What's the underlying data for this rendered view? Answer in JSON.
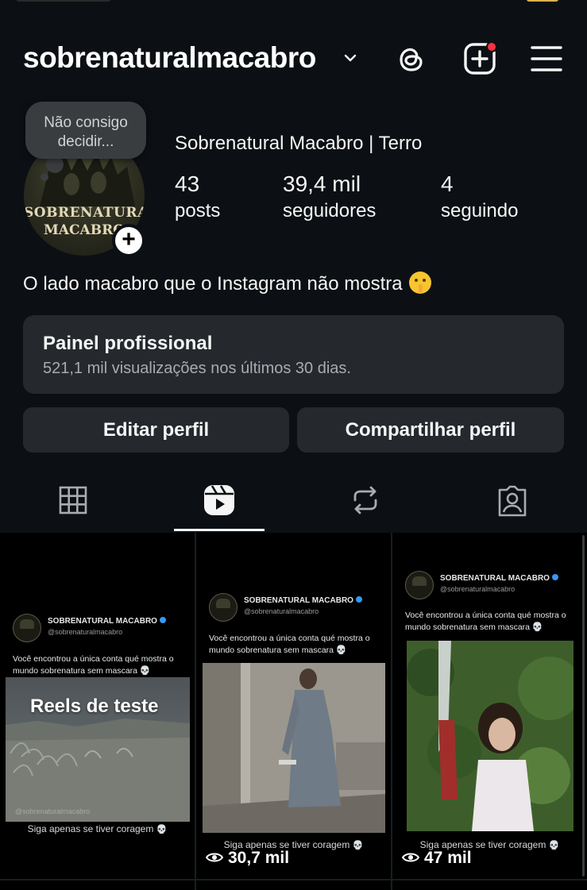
{
  "header": {
    "username": "sobrenaturalmacabro"
  },
  "profile": {
    "note": "Não consigo decidir...",
    "avatar_line1": "SOBRENATURAL",
    "avatar_line2": "MACABRO",
    "display_name": "Sobrenatural Macabro | Terro",
    "stats": [
      {
        "value": "43",
        "label": "posts"
      },
      {
        "value": "39,4 mil",
        "label": "seguidores"
      },
      {
        "value": "4",
        "label": "seguindo"
      }
    ],
    "bio": "O lado macabro que o Instagram não mostra"
  },
  "dashboard": {
    "title": "Painel profissional",
    "subtitle": "521,1 mil visualizações nos últimos 30 dias."
  },
  "buttons": {
    "edit": "Editar perfil",
    "share": "Compartilhar perfil"
  },
  "reels": [
    {
      "account_name": "SOBRENATURAL MACABRO",
      "handle": "@sobrenaturalmacabro",
      "caption": "Você encontrou a única conta qué mostra o mundo sobrenatura sem mascara",
      "footer": "Siga apenas se tiver coragem",
      "overlay_title": "Reels de teste",
      "watermark": "@sobrenaturalmacabro",
      "views": ""
    },
    {
      "account_name": "SOBRENATURAL MACABRO",
      "handle": "@sobrenaturalmacabro",
      "caption": "Você encontrou a única conta qué mostra o mundo sobrenatura sem mascara",
      "footer": "Siga apenas se tiver coragem",
      "views": "30,7 mil"
    },
    {
      "account_name": "SOBRENATURAL MACABRO",
      "handle": "@sobrenaturalmacabro",
      "caption": "Você encontrou a única conta qué mostra o mundo sobrenatura sem mascara",
      "footer": "Siga apenas se tiver coragem",
      "views": "47 mil"
    }
  ],
  "colors": {
    "background": "#0c1014",
    "card": "#25292e",
    "notification": "#ff3040"
  }
}
